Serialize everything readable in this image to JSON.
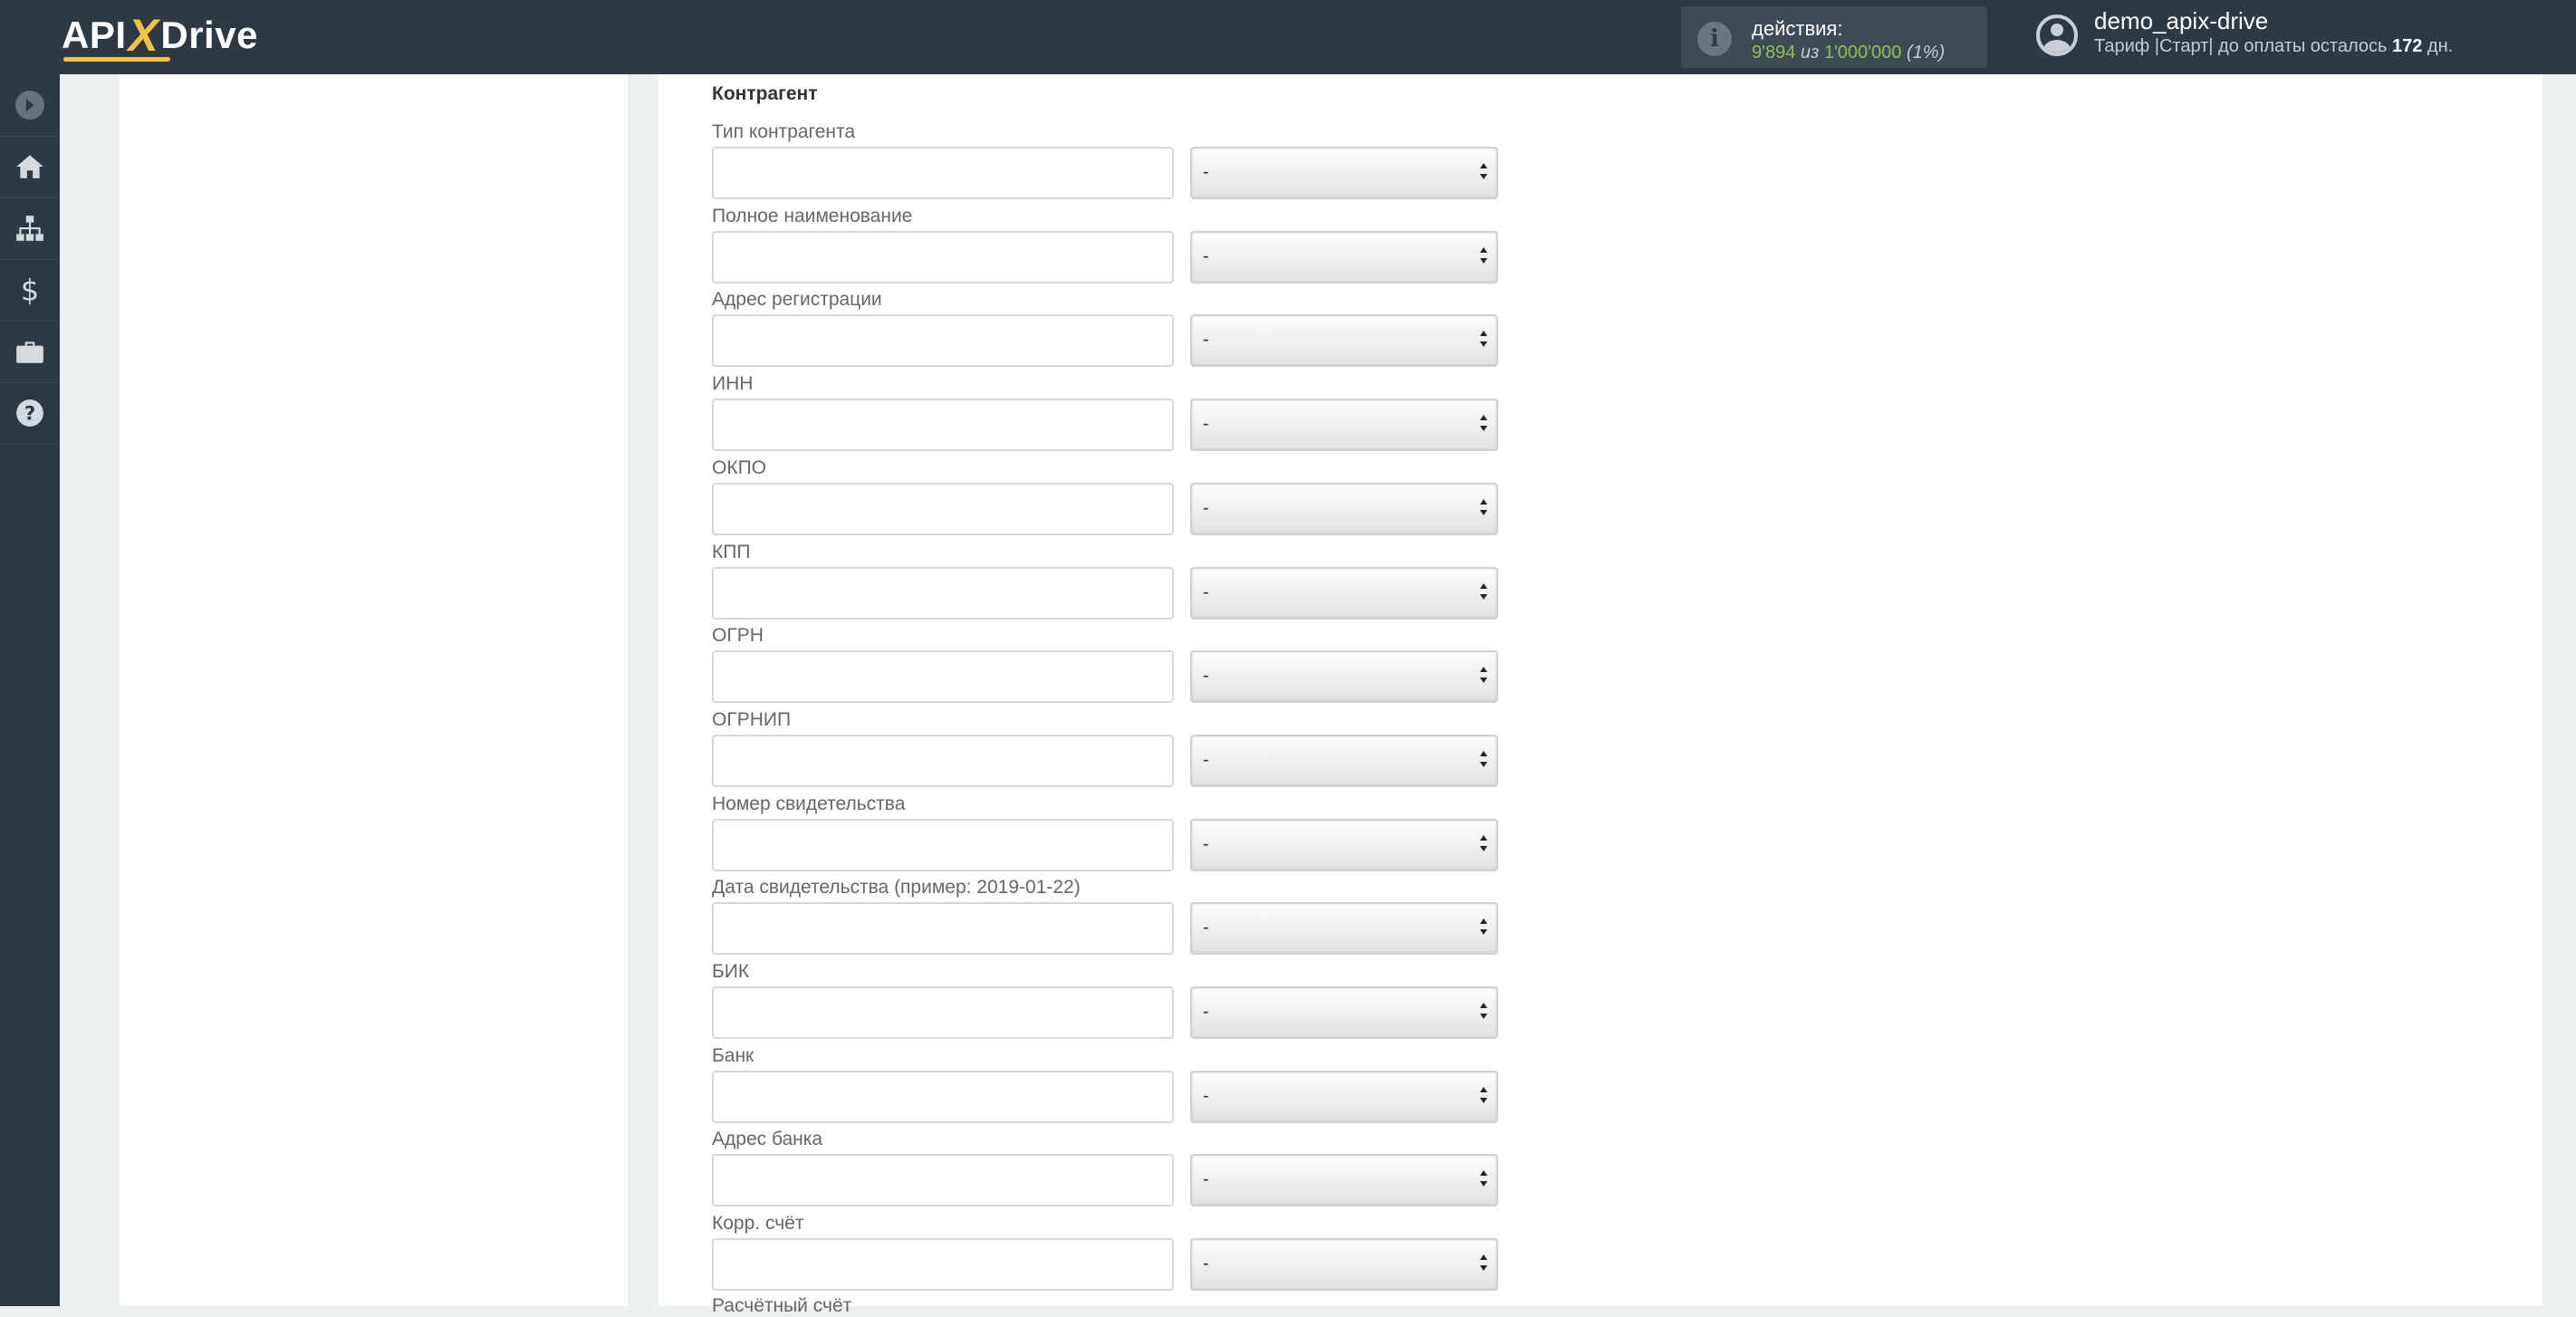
{
  "header": {
    "logo_left": "API",
    "logo_x": "X",
    "logo_right": "Drive",
    "actions_label": "действия:",
    "actions_used": "9'894",
    "actions_of": "из",
    "actions_total": "1'000'000",
    "actions_percent": "(1%)",
    "username": "demo_apix-drive",
    "plan_text": "Тариф |Старт| до оплаты осталось",
    "plan_days": "172",
    "plan_days_suffix": "дн."
  },
  "sidebar": {
    "items": [
      {
        "name": "sidebar-collapse",
        "icon": "arrow-circle-icon"
      },
      {
        "name": "sidebar-home",
        "icon": "home-icon"
      },
      {
        "name": "sidebar-connections",
        "icon": "sitemap-icon"
      },
      {
        "name": "sidebar-billing",
        "icon": "dollar-icon"
      },
      {
        "name": "sidebar-services",
        "icon": "briefcase-icon"
      },
      {
        "name": "sidebar-help",
        "icon": "question-icon"
      }
    ]
  },
  "form": {
    "section_title": "Контрагент",
    "select_default": "-",
    "fields": [
      "Тип контрагента",
      "Полное наименование",
      "Адрес регистрации",
      "ИНН",
      "ОКПО",
      "КПП",
      "ОГРН",
      "ОГРНИП",
      "Номер свидетельства",
      "Дата свидетельства (пример: 2019-01-22)",
      "БИК",
      "Банк",
      "Адрес банка",
      "Корр. счёт"
    ],
    "next_field_partial": "Расчётный счёт"
  }
}
